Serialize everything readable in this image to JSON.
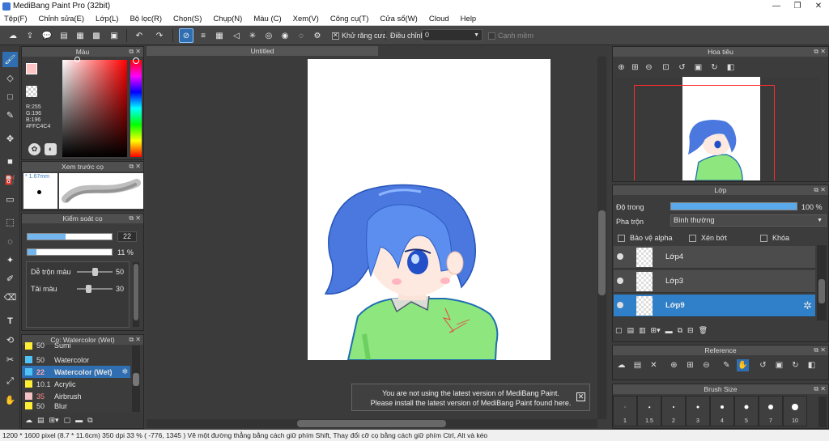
{
  "window": {
    "title": "MediBang Paint Pro (32bit)",
    "minimize": "—",
    "restore": "❐",
    "close": "✕"
  },
  "menu": [
    "Tệp(F)",
    "Chỉnh sửa(E)",
    "Lớp(L)",
    "Bộ lọc(R)",
    "Chọn(S)",
    "Chụp(N)",
    "Màu (C)",
    "Xem(V)",
    "Công cụ(T)",
    "Cửa sổ(W)",
    "Cloud",
    "Help"
  ],
  "toolbar": {
    "antialias_label": "Khử răng cưa",
    "correction_label": "Điều chỉnh",
    "correction_value": "0",
    "sharp_label": "Cạnh mềm"
  },
  "color_panel": {
    "title": "Màu",
    "r": "R:255",
    "g": "G:196",
    "b": "B:196",
    "hex": "#FFC4C4"
  },
  "brush_preview": {
    "title": "Xem trước cọ",
    "size": "1.67mm"
  },
  "brush_control": {
    "title": "Kiểm soát cọ",
    "size_value": "22",
    "opacity_value": "11 %",
    "opacity_fraction": 0.11,
    "size_fraction": 0.45,
    "blend_label": "Dễ trộn màu",
    "blend_value": "50",
    "amount_label": "Tải màu",
    "amount_value": "30",
    "blend_fraction": 0.5,
    "amount_fraction": 0.3
  },
  "brush_list": {
    "title": "Cọ: Watercolor (Wet)",
    "items": [
      {
        "size": "50",
        "name": "Sumi",
        "color": "#ffee33"
      },
      {
        "size": "50",
        "name": "Watercolor",
        "color": "#4fc3f7"
      },
      {
        "size": "22",
        "name": "Watercolor (Wet)",
        "color": "#4fc3f7"
      },
      {
        "size": "10.1",
        "name": "Acrylic",
        "color": "#ffee33"
      },
      {
        "size": "35",
        "name": "Airbrush",
        "color": "#f4c2c2"
      },
      {
        "size": "50",
        "name": "Blur",
        "color": "#ffee33"
      }
    ]
  },
  "document": {
    "tab": "Untitled"
  },
  "navigator": {
    "title": "Hoa tiêu"
  },
  "layers": {
    "title": "Lớp",
    "opacity_label": "Độ trong",
    "opacity_value": "100 %",
    "blend_label": "Pha trộn",
    "blend_value": "Bình thường",
    "protect_alpha": "Bảo vệ alpha",
    "clipping": "Xén bớt",
    "lock": "Khóa",
    "items": [
      {
        "name": "Lớp4"
      },
      {
        "name": "Lớp3"
      },
      {
        "name": "Lớp9"
      }
    ]
  },
  "reference": {
    "title": "Reference"
  },
  "brush_size": {
    "title": "Brush Size",
    "sizes": [
      "1",
      "1.5",
      "2",
      "3",
      "4",
      "5",
      "7",
      "10"
    ]
  },
  "notice": {
    "line1": "You are not using the latest version of MediBang Paint.",
    "line2": "Please install the latest version of MediBang Paint found here."
  },
  "status": {
    "text": "1200 * 1600 pixel   (8.7 * 11.6cm)   350 dpi   33 %   ( -776, 1345 )   Vẽ một đường thẳng bằng cách giữ phím Shift, Thay đổi cỡ cọ bằng cách giữ phím Ctrl, Alt và kéo"
  },
  "colors": {
    "accent": "#2f6fb1",
    "primary": "#ffc4c4"
  }
}
